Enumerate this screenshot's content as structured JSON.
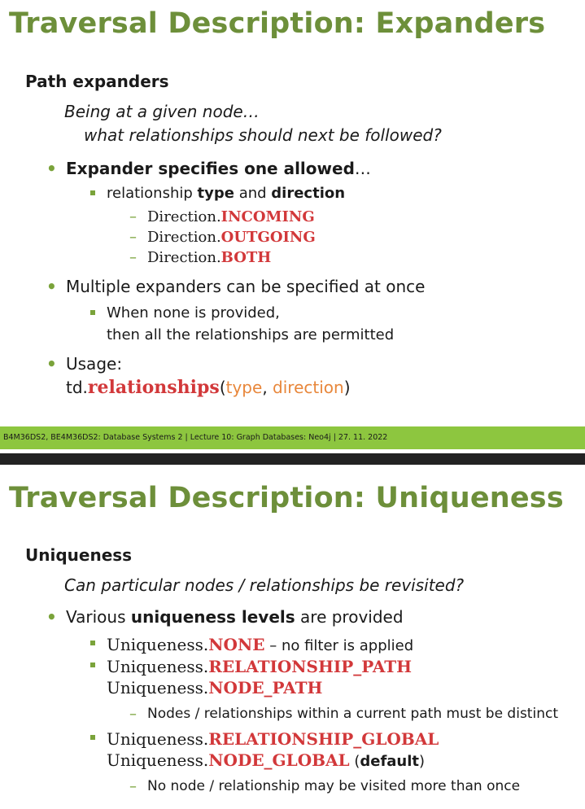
{
  "slide1": {
    "title": "Traversal Description: Expanders",
    "heading": "Path expanders",
    "italic_line1": "Being at a given node…",
    "italic_line2": "what relationships should next be followed?",
    "bullet1": {
      "bold": "Expander specifies one allowed",
      "rest": "…"
    },
    "sub1": {
      "pre": "relationship ",
      "b1": "type",
      "mid": " and ",
      "b2": "direction"
    },
    "directions": [
      {
        "prefix": "Direction.",
        "value": "INCOMING"
      },
      {
        "prefix": "Direction.",
        "value": "OUTGOING"
      },
      {
        "prefix": "Direction.",
        "value": "BOTH"
      }
    ],
    "bullet2": "Multiple expanders can be specified at once",
    "sub2_line1": "When none is provided,",
    "sub2_line2": "then all the relationships are permitted",
    "bullet3": "Usage:",
    "usage": {
      "obj": "td.",
      "method": "relationships",
      "open": "(",
      "arg1": "type",
      "comma": ", ",
      "arg2": "direction",
      "close": ")"
    },
    "footer": "B4M36DS2, BE4M36DS2:  Database Systems 2  |  Lecture 10: Graph Databases: Neo4j | 27. 11. 2022"
  },
  "slide2": {
    "title": "Traversal Description: Uniqueness",
    "heading": "Uniqueness",
    "italic_line": "Can particular nodes / relationships be revisited?",
    "bullet1": {
      "pre": "Various ",
      "bold": "uniqueness levels",
      "post": " are provided"
    },
    "item1": {
      "prefix": "Uniqueness.",
      "value": "NONE",
      "rest": " – no filter is applied"
    },
    "item2": {
      "prefix": "Uniqueness.",
      "value": "RELATIONSHIP_PATH"
    },
    "item2b": {
      "prefix": "Uniqueness.",
      "value": "NODE_PATH"
    },
    "item2_note": "Nodes / relationships within a current path must be distinct",
    "item3": {
      "prefix": "Uniqueness.",
      "value": "RELATIONSHIP_GLOBAL"
    },
    "item3b": {
      "prefix": "Uniqueness.",
      "value": "NODE_GLOBAL",
      "open": " (",
      "bold": "default",
      "close": ")"
    },
    "item3_note": "No node / relationship may be visited more than once"
  },
  "colors": {
    "title": "#6d8f3a",
    "bullet": "#7aa33a",
    "red": "#d2383a",
    "orange": "#e8873b",
    "footer_bar": "#8dc63f"
  }
}
